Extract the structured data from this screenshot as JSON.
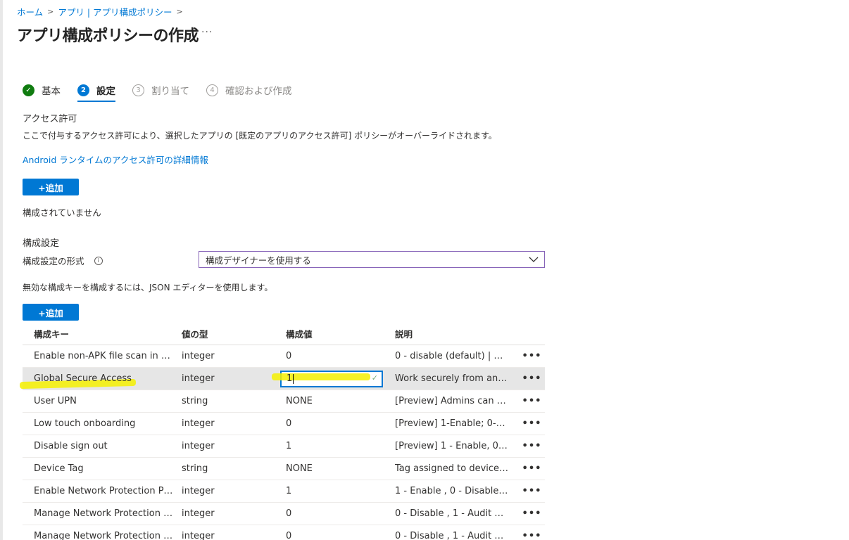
{
  "breadcrumb": {
    "home": "ホーム",
    "apps": "アプリ | アプリ構成ポリシー"
  },
  "page": {
    "title": "アプリ構成ポリシーの作成",
    "more": "···"
  },
  "steps": [
    {
      "num": "✓",
      "label": "基本",
      "state": "done"
    },
    {
      "num": "2",
      "label": "設定",
      "state": "active"
    },
    {
      "num": "3",
      "label": "割り当て",
      "state": "pending"
    },
    {
      "num": "4",
      "label": "確認および作成",
      "state": "pending"
    }
  ],
  "permissions": {
    "title": "アクセス許可",
    "description": "ここで付与するアクセス許可により、選択したアプリの [既定のアプリのアクセス許可] ポリシーがオーバーライドされます。",
    "link": "Android ランタイムのアクセス許可の詳細情報",
    "add_label": "+追加",
    "empty_text": "構成されていません"
  },
  "config": {
    "title": "構成設定",
    "format_label": "構成設定の形式",
    "format_value": "構成デザイナーを使用する",
    "note": "無効な構成キーを構成するには、JSON エディターを使用します。",
    "add_label": "+追加"
  },
  "table": {
    "headers": [
      "構成キー",
      "値の型",
      "構成値",
      "説明"
    ],
    "rows": [
      {
        "key": "Enable non-APK file scan in M…",
        "type": "integer",
        "value": "0",
        "desc": "0 - disable (default) | …"
      },
      {
        "key": "Global Secure Access",
        "type": "integer",
        "value": "1",
        "desc": "Work securely from an…"
      },
      {
        "key": "User UPN",
        "type": "string",
        "value": "NONE",
        "desc": "[Preview] Admins can …"
      },
      {
        "key": "Low touch onboarding",
        "type": "integer",
        "value": "0",
        "desc": "[Preview] 1-Enable; 0-…"
      },
      {
        "key": "Disable sign out",
        "type": "integer",
        "value": "1",
        "desc": "[Preview] 1 - Enable, 0…"
      },
      {
        "key": "Device Tag",
        "type": "string",
        "value": "NONE",
        "desc": "Tag assigned to device…"
      },
      {
        "key": "Enable Network Protection Pri…",
        "type": "integer",
        "value": "1",
        "desc": "1 - Enable , 0 - Disable…"
      },
      {
        "key": "Manage Network Protection …",
        "type": "integer",
        "value": "0",
        "desc": "0 - Disable , 1 - Audit …"
      },
      {
        "key": "Manage Network Protection …",
        "type": "integer",
        "value": "0",
        "desc": "0 - Disable , 1 - Audit …"
      }
    ],
    "more": "•••"
  },
  "colors": {
    "accent": "#0078d4",
    "success": "#107c10",
    "highlight": "#f5f000",
    "select_border": "#8764b8"
  }
}
